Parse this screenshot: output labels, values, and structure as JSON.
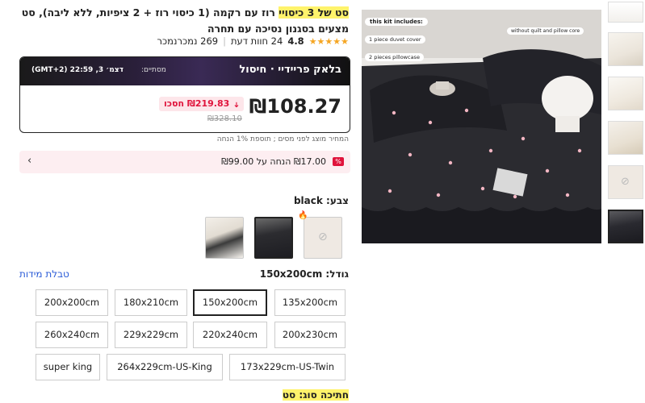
{
  "product": {
    "title_highlight": "סט של 3 כיסויי",
    "title_rest": " רוז עם רקמה (1 כיסוי רוז + 2 ציפיות, ללא ליבה), סט מצעים בסגנון נסיכה עם תחרה",
    "rating": "4.8",
    "reviews": "24 חוות דעת",
    "sold": "269 נמכרנמכר"
  },
  "deal": {
    "name": "בלאק פריידיי · חיסול",
    "ends_label": "מסתיים:",
    "ends_time": "דצמ׳ 3, 22:59 (GMT+2)",
    "price": "₪108.27",
    "save": "₪219.83 חסכו",
    "save_arrow": "➜",
    "old_price": "₪328.10"
  },
  "tax_note": "המחיר מוצג לפני מסים ; תוספת 1% הנחה",
  "coupon": {
    "text": "₪17.00 הנחה על ₪99.00",
    "chevron": "‹",
    "icon": "tag-icon"
  },
  "color": {
    "label": "צבע: black",
    "options": [
      {
        "name": "white",
        "selected": false
      },
      {
        "name": "black",
        "selected": true
      },
      {
        "name": "unavailable",
        "selected": false
      }
    ],
    "fire": "🔥"
  },
  "size": {
    "label": "גודל: 150x200cm",
    "chart_link": "טבלת מידות",
    "options": [
      "135x200cm",
      "150x200cm",
      "180x210cm",
      "200x200cm",
      "200x230cm",
      "220x240cm",
      "229x229cm",
      "260x240cm",
      "173x229cm-US-Twin",
      "264x229cm-US-King",
      "super king"
    ],
    "selected": "150x200cm"
  },
  "type": {
    "label": "חתיכה סוג: סט"
  },
  "image": {
    "kit_label": "this kit includes:",
    "item1": "1 piece duvet cover",
    "item2": "2 pieces pillowcase",
    "item3": "without quilt and pillow core"
  },
  "colors": {
    "accent_red": "#e0143c",
    "link_blue": "#2a5bd7",
    "highlight": "#fff36b",
    "star": "#f5a623"
  }
}
